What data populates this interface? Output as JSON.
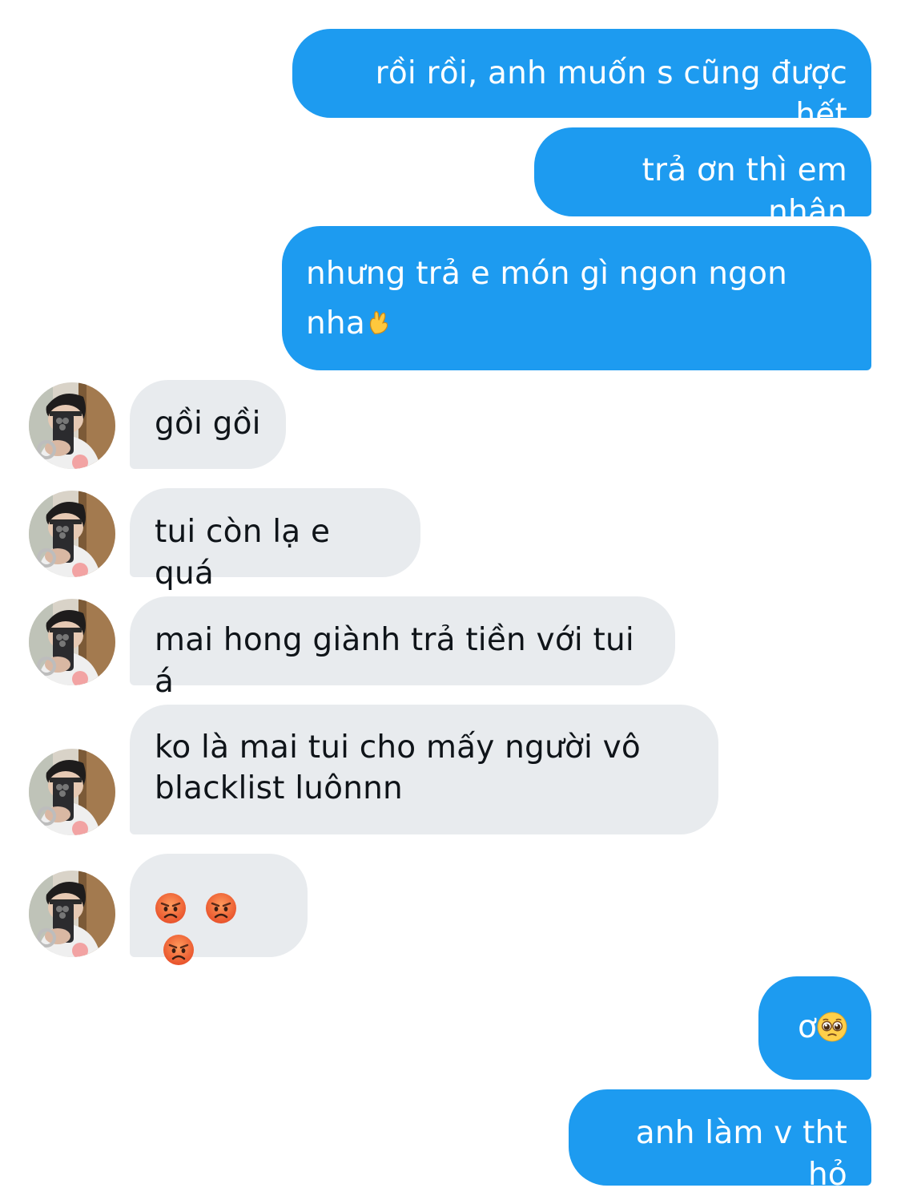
{
  "conversation": {
    "outgoing": [
      {
        "text": "rồi rồi, anh muốn s cũng được hết"
      },
      {
        "text": "trả ơn thì em nhận"
      },
      {
        "text": "nhưng trả e món gì ngon ngon\nnha",
        "emoji": "pinching-hand-emoji"
      },
      {
        "text": "ơ",
        "emoji": "pleading-face-emoji"
      },
      {
        "text": "anh làm v tht hỏ"
      }
    ],
    "incoming": [
      {
        "text": "gồi gồi"
      },
      {
        "text": "tui còn lạ e quá"
      },
      {
        "text": "mai hong giành trả tiền với tui á"
      },
      {
        "text": "ko là mai tui cho mấy người vô\nblacklist luônnn"
      },
      {
        "emojis": [
          "angry-face-emoji",
          "angry-face-emoji",
          "angry-face-emoji"
        ]
      }
    ]
  },
  "colors": {
    "outgoing_bubble": "#1d9bf0",
    "incoming_bubble": "#e8ebee",
    "incoming_text": "#0f1419",
    "background": "#ffffff"
  },
  "icons": {
    "avatar": "avatar-photo"
  }
}
